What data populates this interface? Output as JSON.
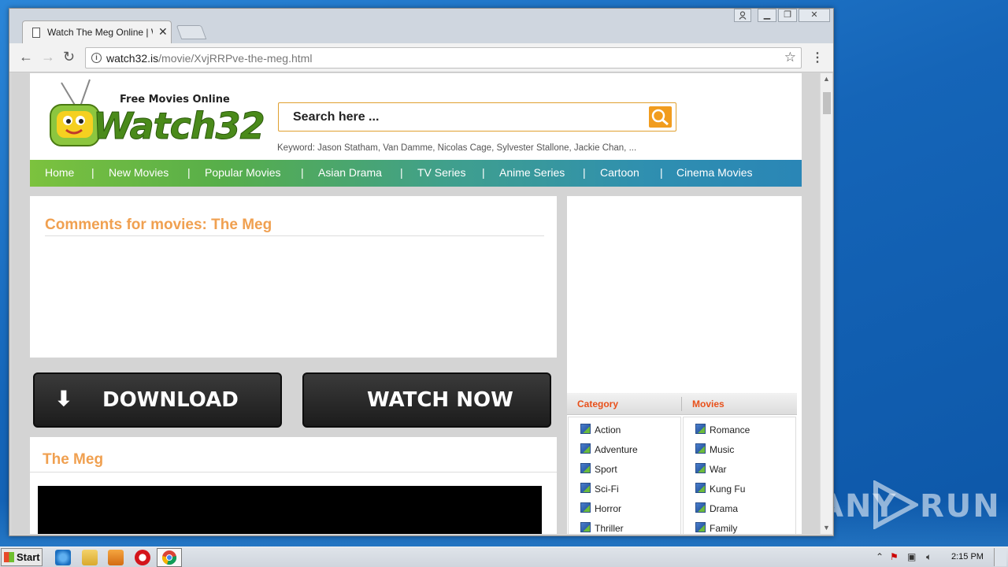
{
  "browser": {
    "tab_title": "Watch The Meg Online | Wa",
    "url_host": "watch32.is",
    "url_path": "/movie/XvjRRPve-the-meg.html"
  },
  "site": {
    "tagline": "Free Movies Online",
    "logo_text": "Watch32",
    "search_placeholder": "Search here ...",
    "keywords": "Keyword: Jason Statham, Van Damme, Nicolas Cage, Sylvester Stallone, Jackie Chan, ...",
    "nav": [
      "Home",
      "New Movies",
      "Popular Movies",
      "Asian Drama",
      "TV Series",
      "Anime Series",
      "Cartoon",
      "Cinema Movies"
    ],
    "nav_separator": "|"
  },
  "comments": {
    "heading": "Comments for movies: The Meg"
  },
  "buttons": {
    "download": "DOWNLOAD",
    "download_arrow": "⬇",
    "watch_now": "WATCH NOW"
  },
  "movie": {
    "title": "The Meg"
  },
  "sidebar": {
    "category_heading": "Category",
    "movies_heading": "Movies",
    "left_items": [
      "Action",
      "Adventure",
      "Sport",
      "Sci-Fi",
      "Horror",
      "Thriller"
    ],
    "right_items": [
      "Romance",
      "Music",
      "War",
      "Kung Fu",
      "Drama",
      "Family"
    ]
  },
  "taskbar": {
    "start_label": "Start",
    "clock": "2:15 PM"
  },
  "watermark": {
    "left": "ANY",
    "right": "RUN"
  },
  "colors": {
    "heading_accent": "#f0a050",
    "category_accent": "#e8501a",
    "search_button": "#f19c1e"
  }
}
